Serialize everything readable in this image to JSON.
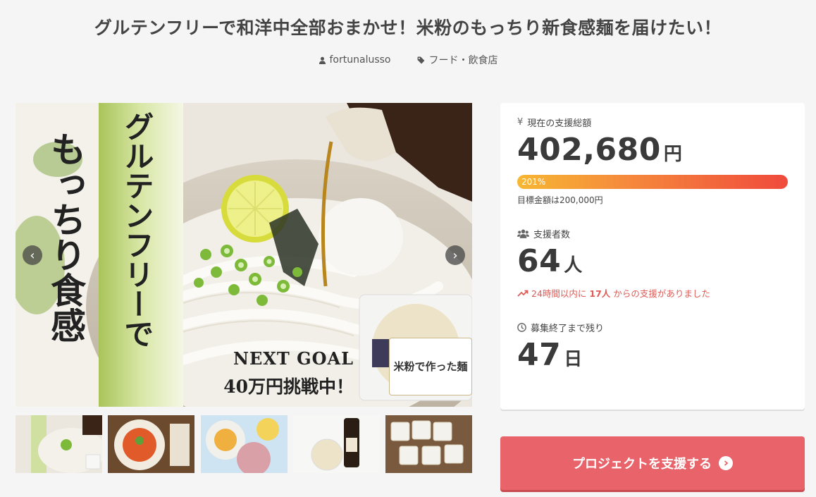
{
  "project": {
    "title": "グルテンフリーで和洋中全部おまかせ！米粉のもっちり新食感麺を届けたい！",
    "author": "fortunalusso",
    "category": "フード・飲食店"
  },
  "hero": {
    "vertical_text_1": "グルテンフリーで",
    "vertical_text_2": "もっちり食感",
    "goal_line_1": "NEXT GOAL",
    "goal_line_2": "40万円挑戦中！",
    "package_label": "米粉で作った麺",
    "prev_label": "‹",
    "next_label": "›"
  },
  "thumbnails": [
    {
      "name": "thumb-1"
    },
    {
      "name": "thumb-2"
    },
    {
      "name": "thumb-3"
    },
    {
      "name": "thumb-4"
    },
    {
      "name": "thumb-5"
    }
  ],
  "stats": {
    "total_label": "現在の支援総額",
    "total_amount": "402,680",
    "total_unit": "円",
    "progress_percent": 201,
    "progress_label": "201%",
    "goal_text": "目標金額は200,000円",
    "supporters_label": "支援者数",
    "supporters_count": "64",
    "supporters_unit": "人",
    "recent_prefix": "24時間以内に",
    "recent_count": "17人",
    "recent_suffix": "からの支援がありました",
    "remaining_label": "募集終了まで残り",
    "remaining_days": "47",
    "remaining_unit": "日"
  },
  "cta": {
    "label": "プロジェクトを支援する"
  },
  "colors": {
    "accent": "#e8636a",
    "recent": "#e05a55"
  }
}
